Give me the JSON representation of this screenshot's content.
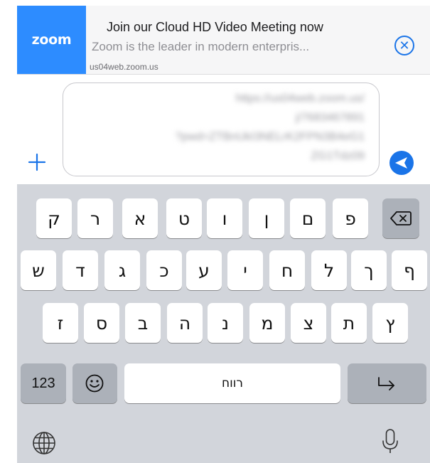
{
  "link_preview": {
    "logo_text": "zoom",
    "title": "Join our Cloud HD Video Meeting now",
    "description": "Zoom is the leader in modern enterpris...",
    "domain": "us04web.zoom.us",
    "close_glyph": "✕",
    "brand_color": "#2d8cff"
  },
  "composer": {
    "blurred_message_lines": [
      "https://us04web.zoom.us/",
      "j/7683467891",
      "?pwd=ZTBnUkI3NELrK2FPN3B4eG1",
      "ZG1Tdz09"
    ],
    "add_icon": "plus-icon",
    "send_icon": "send-arrow-icon",
    "accent_color": "#1a74e8"
  },
  "keyboard": {
    "row1": [
      "ק",
      "ר",
      "א",
      "ט",
      "ו",
      "ן",
      "ם",
      "פ"
    ],
    "row2": [
      "ש",
      "ד",
      "ג",
      "כ",
      "ע",
      "י",
      "ח",
      "ל",
      "ך",
      "ף"
    ],
    "row3": [
      "ז",
      "ס",
      "ב",
      "ה",
      "נ",
      "מ",
      "צ",
      "ת",
      "ץ"
    ],
    "numbers_label": "123",
    "space_label": "רווח",
    "backspace_icon": "backspace-icon",
    "emoji_icon": "emoji-icon",
    "return_icon": "return-icon",
    "globe_icon": "globe-icon",
    "mic_icon": "microphone-icon"
  }
}
